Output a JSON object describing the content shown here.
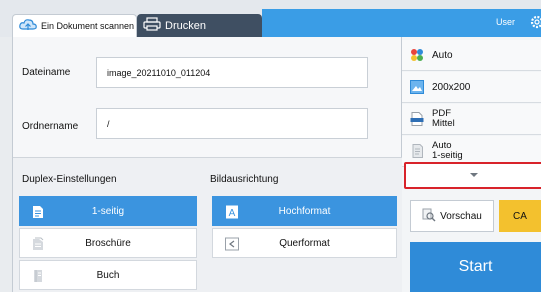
{
  "tabs": {
    "scan_label": "Ein Dokument scannen",
    "print_label": "Drucken"
  },
  "header": {
    "user_label": "User"
  },
  "fields": {
    "filename_label": "Dateiname",
    "filename_value": "image_20211010_011204",
    "folder_label": "Ordnername",
    "folder_value": "/"
  },
  "duplex": {
    "title": "Duplex-Einstellungen",
    "options": [
      "1-seitig",
      "Broschüre",
      "Buch"
    ],
    "selected_index": 0
  },
  "orientation": {
    "title": "Bildausrichtung",
    "options": [
      "Hochformat",
      "Querformat"
    ],
    "selected_index": 0
  },
  "right_panel": {
    "color_mode": "Auto",
    "resolution": "200x200",
    "format_line1": "PDF",
    "format_line2": "Mittel",
    "size_line1": "Auto",
    "size_line2": "1-seitig",
    "preview_label": "Vorschau",
    "ca_label": "CA",
    "start_label": "Start"
  },
  "colors": {
    "accent_blue": "#3b94df",
    "header_blue": "#3a9de6",
    "dark_tab": "#3f4f62",
    "ca_yellow": "#f3c12e",
    "highlight_red": "#d8232a"
  },
  "icons": {
    "scan_tab": "cloud-scan-icon",
    "print_tab": "printer-icon",
    "settings": "gear-icon",
    "more": "chevron-down-icon",
    "preview": "magnifier-icon"
  }
}
